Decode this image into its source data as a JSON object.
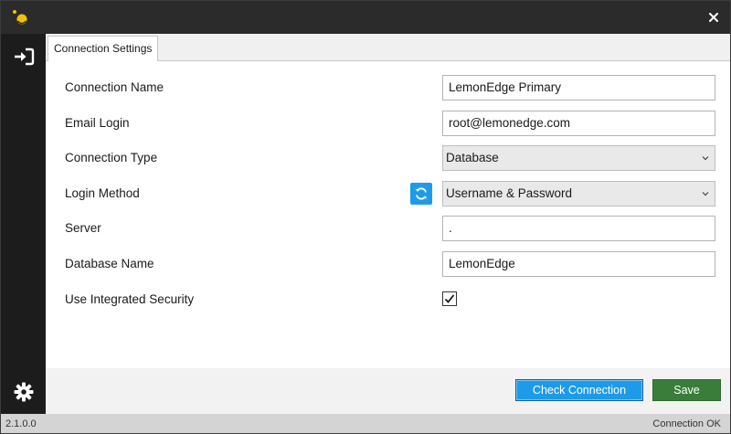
{
  "window": {
    "close_icon": "close-icon"
  },
  "sidebar": {
    "login_icon": "sign-in-icon",
    "settings_icon": "gear-icon"
  },
  "tabs": [
    {
      "label": "Connection Settings",
      "active": true
    }
  ],
  "form": {
    "connection_name": {
      "label": "Connection Name",
      "value": "LemonEdge Primary"
    },
    "email_login": {
      "label": "Email Login",
      "value": "root@lemonedge.com"
    },
    "connection_type": {
      "label": "Connection Type",
      "value": "Database"
    },
    "login_method": {
      "label": "Login Method",
      "value": "Username & Password"
    },
    "server": {
      "label": "Server",
      "value": "."
    },
    "database_name": {
      "label": "Database Name",
      "value": "LemonEdge"
    },
    "integrated_security": {
      "label": "Use Integrated Security",
      "checked": true
    }
  },
  "footer": {
    "check_connection_label": "Check Connection",
    "save_label": "Save"
  },
  "status": {
    "version": "2.1.0.0",
    "text": "Connection OK"
  },
  "colors": {
    "titlebar": "#2b2b2b",
    "sidebar": "#1c1c1c",
    "accent_blue": "#1e9be8",
    "save_green": "#3a7d3a",
    "logo_yellow": "#f2c200"
  }
}
